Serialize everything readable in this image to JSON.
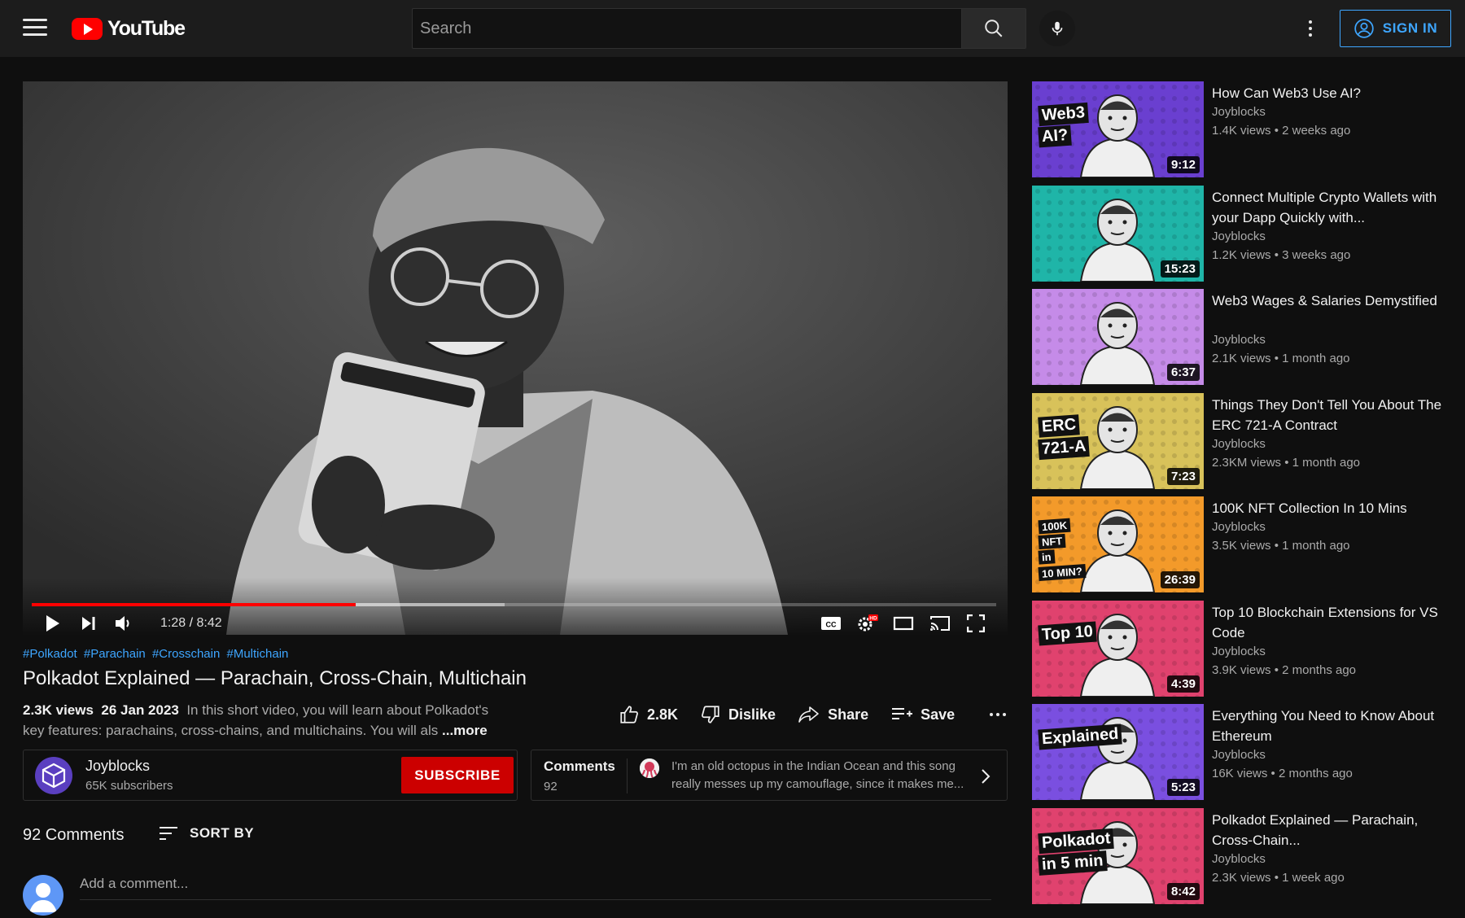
{
  "header": {
    "logo_text": "YouTube",
    "search_placeholder": "Search",
    "signin_label": "SIGN IN"
  },
  "player": {
    "current_time": "1:28",
    "duration": "8:42",
    "progress_fraction": 0.336,
    "buffered_fraction": 0.49
  },
  "video": {
    "hashtags": [
      "#Polkadot",
      "#Parachain",
      "#Crosschain",
      "#Multichain"
    ],
    "title": "Polkadot Explained — Parachain, Cross-Chain, Multichain",
    "views": "2.3K views",
    "date": "26 Jan 2023",
    "description": "In this short video, you will learn about Polkadot's key features: parachains, cross-chains, and multichains. You will als",
    "more_label": "...more",
    "like_count": "2.8K",
    "dislike_label": "Dislike",
    "share_label": "Share",
    "save_label": "Save"
  },
  "channel": {
    "name": "Joyblocks",
    "subscribers": "65K subscribers",
    "subscribe_label": "SUBSCRIBE"
  },
  "comments_teaser": {
    "label": "Comments",
    "count": "92",
    "preview": "I'm an old octopus in the Indian Ocean and this song really messes up my camouflage, since it makes me..."
  },
  "comments": {
    "heading": "92 Comments",
    "sort_label": "SORT BY",
    "add_placeholder": "Add a comment..."
  },
  "recommendations": [
    {
      "title": "How Can Web3 Use AI?",
      "channel": "Joyblocks",
      "meta": "1.4K views • 2 weeks ago",
      "duration": "9:12",
      "thumb_bg": "#6a3fd0",
      "thumb_text": [
        "Web3",
        "AI?"
      ]
    },
    {
      "title": "Connect Multiple Crypto Wallets with your Dapp Quickly with...",
      "channel": "Joyblocks",
      "meta": "1.2K views • 3 weeks ago",
      "duration": "15:23",
      "thumb_bg": "#1fb5a8",
      "thumb_text": []
    },
    {
      "title": "Web3 Wages & Salaries Demystified",
      "channel": "Joyblocks",
      "meta": "2.1K views • 1 month ago",
      "duration": "6:37",
      "thumb_bg": "#c58be8",
      "thumb_text": []
    },
    {
      "title": "Things They Don't Tell You About The ERC 721-A Contract",
      "channel": "Joyblocks",
      "meta": "2.3KM views • 1 month ago",
      "duration": "7:23",
      "thumb_bg": "#d8c25a",
      "thumb_text": [
        "ERC",
        "721-A"
      ]
    },
    {
      "title": "100K NFT Collection In 10 Mins",
      "channel": "Joyblocks",
      "meta": "3.5K views • 1 month ago",
      "duration": "26:39",
      "thumb_bg": "#f39a2a",
      "thumb_text": [
        "100K",
        "NFT",
        "in",
        "10 MIN?"
      ]
    },
    {
      "title": "Top 10 Blockchain Extensions for VS Code",
      "channel": "Joyblocks",
      "meta": "3.9K views • 2 months ago",
      "duration": "4:39",
      "thumb_bg": "#e0426e",
      "thumb_text": [
        "Top 10"
      ]
    },
    {
      "title": "Everything You Need to Know About Ethereum",
      "channel": "Joyblocks",
      "meta": "16K views • 2 months ago",
      "duration": "5:23",
      "thumb_bg": "#7a4fe0",
      "thumb_text": [
        "Explained"
      ]
    },
    {
      "title": "Polkadot Explained — Parachain, Cross-Chain...",
      "channel": "Joyblocks",
      "meta": "2.3K views • 1 week ago",
      "duration": "8:42",
      "thumb_bg": "#e0426e",
      "thumb_text": [
        "Polkadot",
        "in 5 min"
      ]
    }
  ],
  "colors": {
    "accent_red": "#ff0000",
    "link_blue": "#3ea6ff",
    "subscribe_red": "#cc0000"
  }
}
